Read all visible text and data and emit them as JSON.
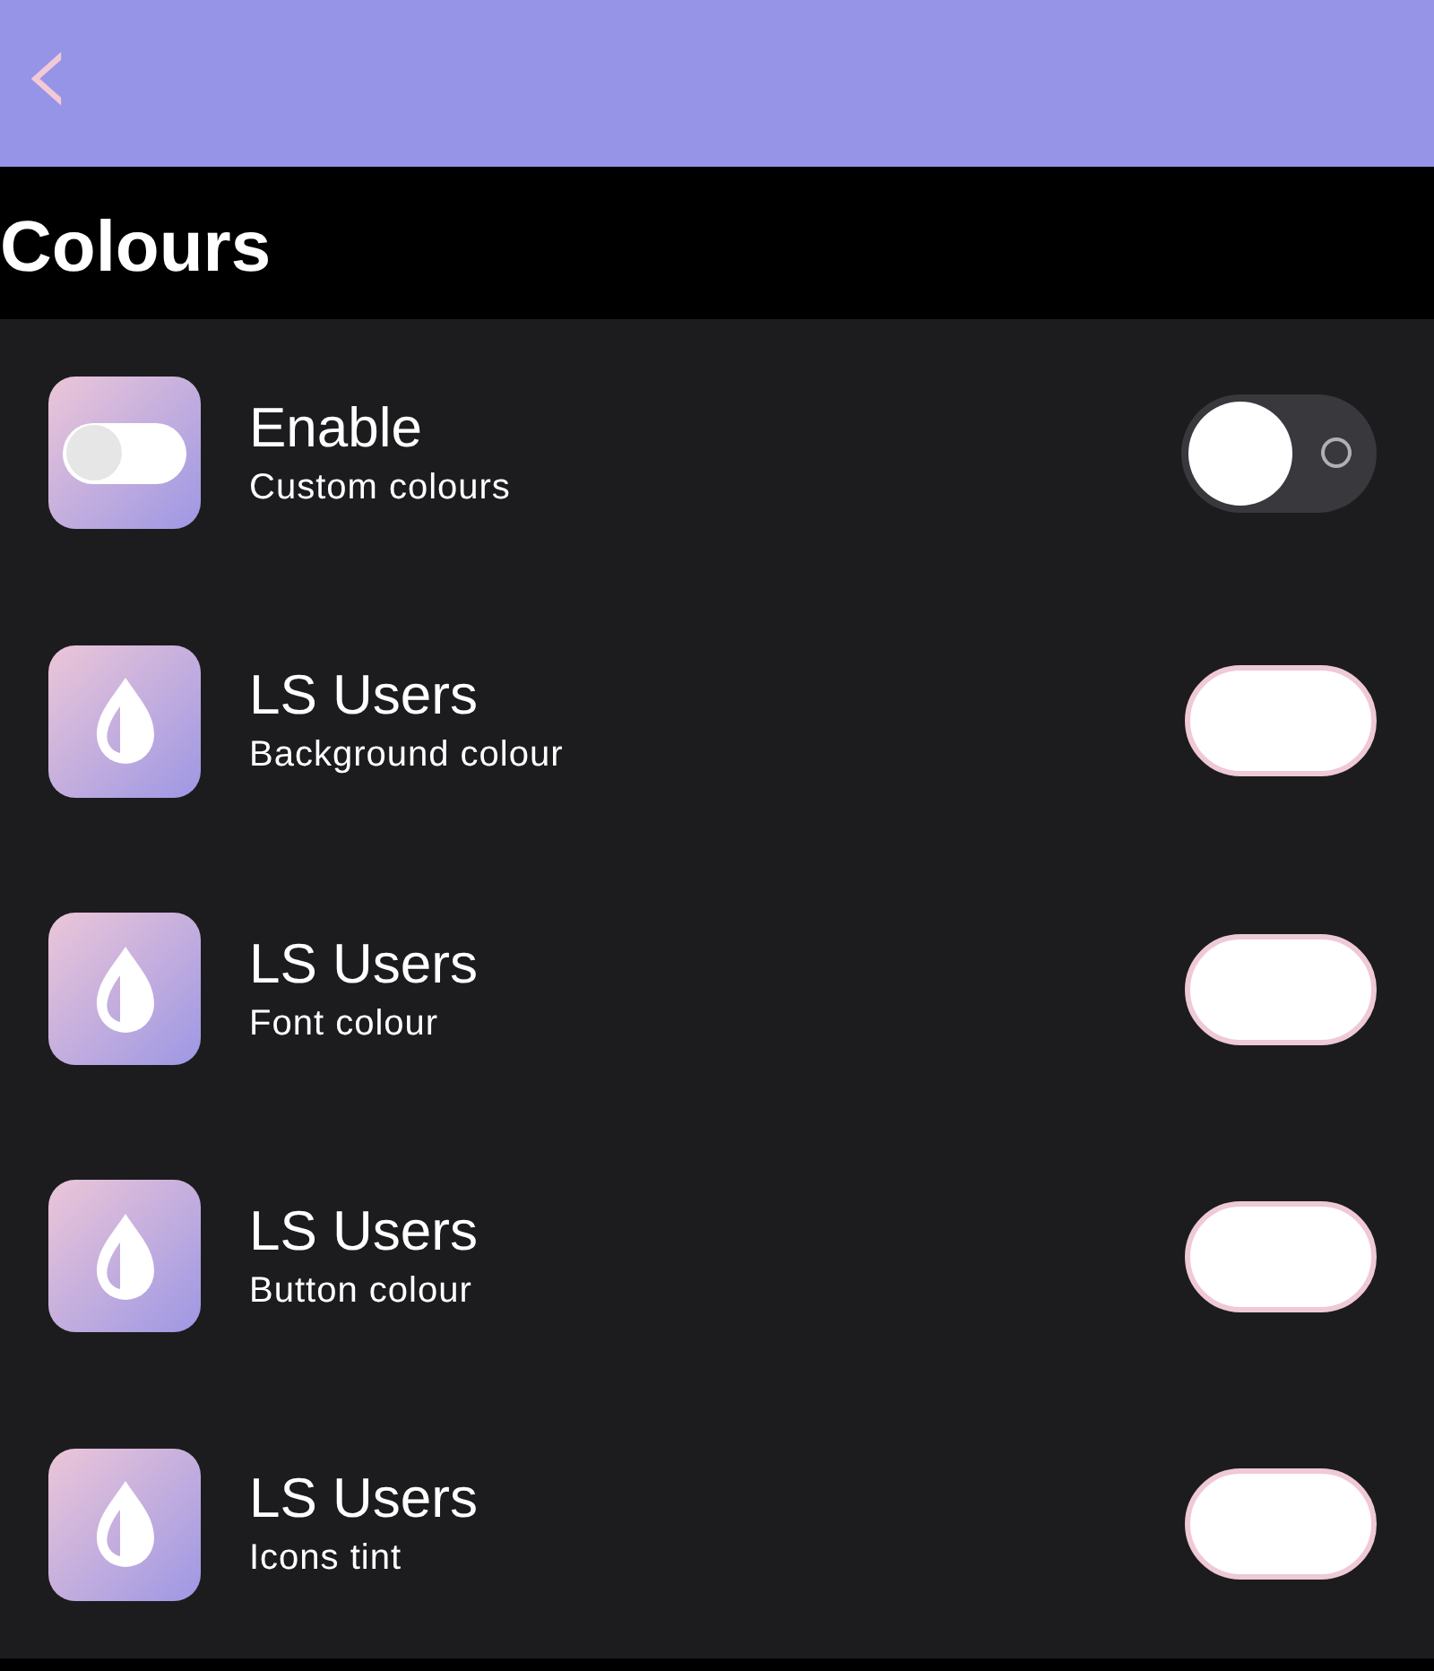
{
  "header": {
    "back": "‹"
  },
  "title": "Colours",
  "rows": [
    {
      "kind": "toggle",
      "title": "Enable",
      "subtitle": "Custom colours",
      "on": false
    },
    {
      "kind": "swatch",
      "title": "LS Users",
      "subtitle": "Background colour",
      "color": "#ffffff"
    },
    {
      "kind": "swatch",
      "title": "LS Users",
      "subtitle": "Font colour",
      "color": "#ffffff"
    },
    {
      "kind": "swatch",
      "title": "LS Users",
      "subtitle": "Button colour",
      "color": "#ffffff"
    },
    {
      "kind": "swatch",
      "title": "LS Users",
      "subtitle": "Icons tint",
      "color": "#ffffff"
    }
  ]
}
